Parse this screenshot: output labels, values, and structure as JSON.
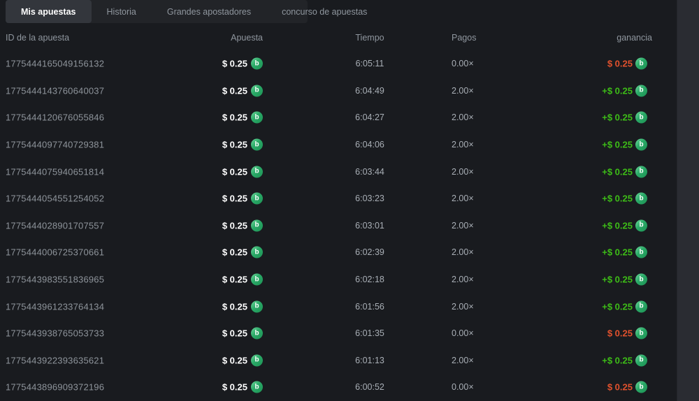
{
  "tabs": [
    {
      "label": "Mis apuestas",
      "active": true
    },
    {
      "label": "Historia",
      "active": false
    },
    {
      "label": "Grandes apostadores",
      "active": false
    },
    {
      "label": "concurso de apuestas",
      "active": false
    }
  ],
  "columns": {
    "id": "ID de la apuesta",
    "bet": "Apuesta",
    "time": "Tiempo",
    "payout": "Pagos",
    "profit": "ganancia"
  },
  "coin": {
    "name": "green-coin-icon",
    "symbol": "b",
    "color": "#2aa967"
  },
  "colors": {
    "win": "#3dbd17",
    "loss": "#e0512d",
    "background": "#191b1f"
  },
  "rows": [
    {
      "id": "1775444165049156132",
      "bet": "$ 0.25",
      "time": "6:05:11",
      "payout": "0.00×",
      "profit": "$ 0.25",
      "result": "loss"
    },
    {
      "id": "1775444143760640037",
      "bet": "$ 0.25",
      "time": "6:04:49",
      "payout": "2.00×",
      "profit": "+$ 0.25",
      "result": "win"
    },
    {
      "id": "1775444120676055846",
      "bet": "$ 0.25",
      "time": "6:04:27",
      "payout": "2.00×",
      "profit": "+$ 0.25",
      "result": "win"
    },
    {
      "id": "1775444097740729381",
      "bet": "$ 0.25",
      "time": "6:04:06",
      "payout": "2.00×",
      "profit": "+$ 0.25",
      "result": "win"
    },
    {
      "id": "1775444075940651814",
      "bet": "$ 0.25",
      "time": "6:03:44",
      "payout": "2.00×",
      "profit": "+$ 0.25",
      "result": "win"
    },
    {
      "id": "1775444054551254052",
      "bet": "$ 0.25",
      "time": "6:03:23",
      "payout": "2.00×",
      "profit": "+$ 0.25",
      "result": "win"
    },
    {
      "id": "1775444028901707557",
      "bet": "$ 0.25",
      "time": "6:03:01",
      "payout": "2.00×",
      "profit": "+$ 0.25",
      "result": "win"
    },
    {
      "id": "1775444006725370661",
      "bet": "$ 0.25",
      "time": "6:02:39",
      "payout": "2.00×",
      "profit": "+$ 0.25",
      "result": "win"
    },
    {
      "id": "1775443983551836965",
      "bet": "$ 0.25",
      "time": "6:02:18",
      "payout": "2.00×",
      "profit": "+$ 0.25",
      "result": "win"
    },
    {
      "id": "1775443961233764134",
      "bet": "$ 0.25",
      "time": "6:01:56",
      "payout": "2.00×",
      "profit": "+$ 0.25",
      "result": "win"
    },
    {
      "id": "1775443938765053733",
      "bet": "$ 0.25",
      "time": "6:01:35",
      "payout": "0.00×",
      "profit": "$ 0.25",
      "result": "loss"
    },
    {
      "id": "1775443922393635621",
      "bet": "$ 0.25",
      "time": "6:01:13",
      "payout": "2.00×",
      "profit": "+$ 0.25",
      "result": "win"
    },
    {
      "id": "1775443896909372196",
      "bet": "$ 0.25",
      "time": "6:00:52",
      "payout": "0.00×",
      "profit": "$ 0.25",
      "result": "loss"
    }
  ]
}
